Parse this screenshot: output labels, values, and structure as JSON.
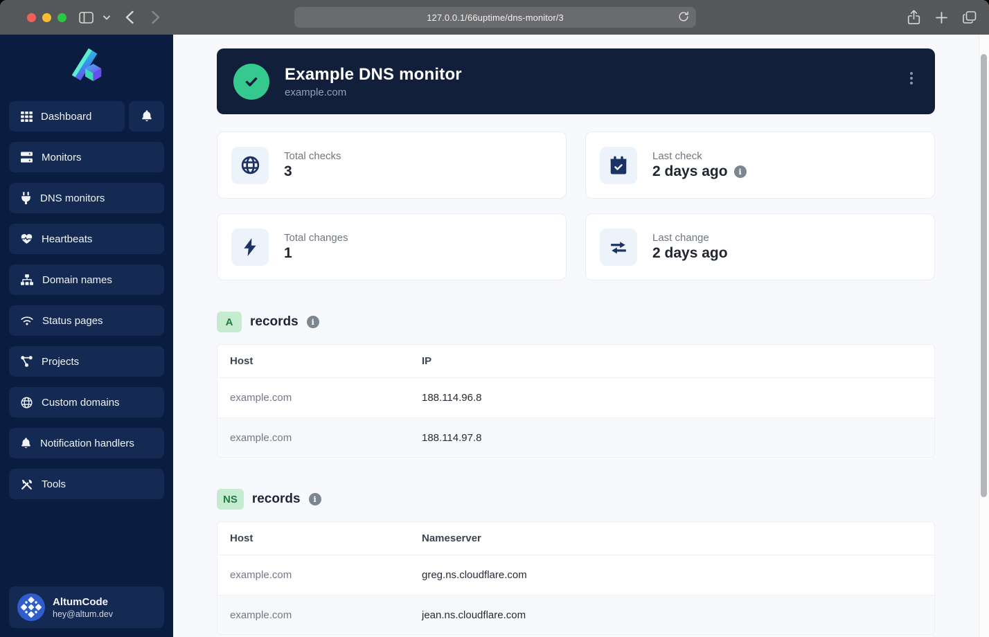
{
  "browser": {
    "url": "127.0.0.1/66uptime/dns-monitor/3"
  },
  "sidebar": {
    "dashboard_label": "Dashboard",
    "items": [
      {
        "label": "Monitors",
        "icon": "server-icon"
      },
      {
        "label": "DNS monitors",
        "icon": "plug-icon"
      },
      {
        "label": "Heartbeats",
        "icon": "heartbeat-icon"
      },
      {
        "label": "Domain names",
        "icon": "sitemap-icon"
      },
      {
        "label": "Status pages",
        "icon": "wifi-icon"
      },
      {
        "label": "Projects",
        "icon": "share-nodes-icon"
      },
      {
        "label": "Custom domains",
        "icon": "globe-icon"
      },
      {
        "label": "Notification handlers",
        "icon": "bell-icon"
      },
      {
        "label": "Tools",
        "icon": "tools-icon"
      }
    ],
    "account": {
      "name": "AltumCode",
      "email": "hey@altum.dev"
    }
  },
  "monitor": {
    "title": "Example DNS monitor",
    "subtitle": "example.com",
    "status": "up"
  },
  "stats": [
    {
      "label": "Total checks",
      "value": "3",
      "icon": "globe-icon"
    },
    {
      "label": "Last check",
      "value": "2 days ago",
      "icon": "calendar-check-icon",
      "info": "i"
    },
    {
      "label": "Total changes",
      "value": "1",
      "icon": "bolt-icon"
    },
    {
      "label": "Last change",
      "value": "2 days ago",
      "icon": "right-left-icon"
    }
  ],
  "sections": [
    {
      "badge": "A",
      "title": "records",
      "info": "i",
      "columns": [
        "Host",
        "IP"
      ],
      "rows": [
        [
          "example.com",
          "188.114.96.8"
        ],
        [
          "example.com",
          "188.114.97.8"
        ]
      ]
    },
    {
      "badge": "NS",
      "title": "records",
      "info": "i",
      "columns": [
        "Host",
        "Nameserver"
      ],
      "rows": [
        [
          "example.com",
          "greg.ns.cloudflare.com"
        ],
        [
          "example.com",
          "jean.ns.cloudflare.com"
        ]
      ]
    }
  ],
  "colors": {
    "sidebar_bg": "#0a1c40",
    "sidebar_item_bg": "#152a52",
    "header_card_bg": "#111f3b",
    "status_green": "#36c98f",
    "badge_green_bg": "#c5ecd1",
    "badge_green_text": "#1f7c40",
    "page_bg": "#f8f9fc",
    "icon_navy": "#1c3263"
  }
}
